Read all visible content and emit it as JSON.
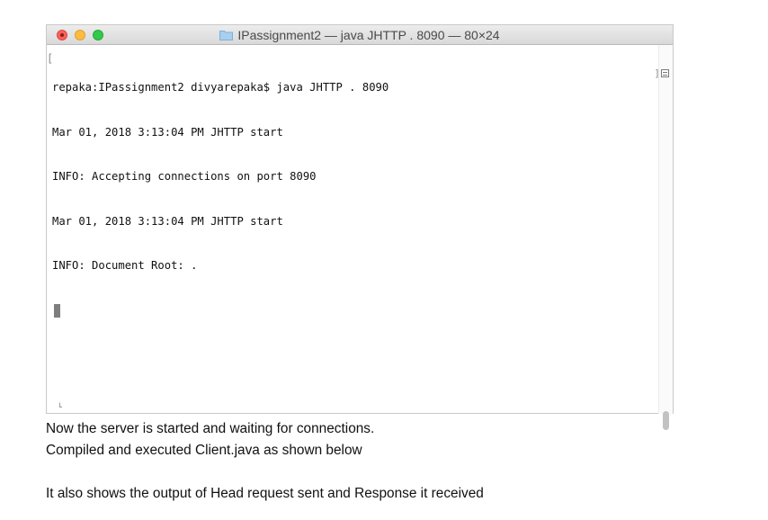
{
  "window": {
    "title": "IPassignment2 — java JHTTP . 8090 — 80×24"
  },
  "terminal": {
    "lines": [
      "repaka:IPassignment2 divyarepaka$ java JHTTP . 8090",
      "Mar 01, 2018 3:13:04 PM JHTTP start",
      "INFO: Accepting connections on port 8090",
      "Mar 01, 2018 3:13:04 PM JHTTP start",
      "INFO: Document Root: ."
    ]
  },
  "document": {
    "paragraph1_line1": "Now the server is started and waiting for connections.",
    "paragraph1_line2": "Compiled and executed Client.java as shown below",
    "paragraph2": "It also shows the output of Head request sent and Response it received"
  },
  "colors": {
    "close": "#fc605c",
    "minimize": "#fdbc40",
    "maximize": "#34c84a"
  },
  "icons": {
    "title_icon": "folder-icon",
    "split_icon": "split-pane-icon"
  }
}
